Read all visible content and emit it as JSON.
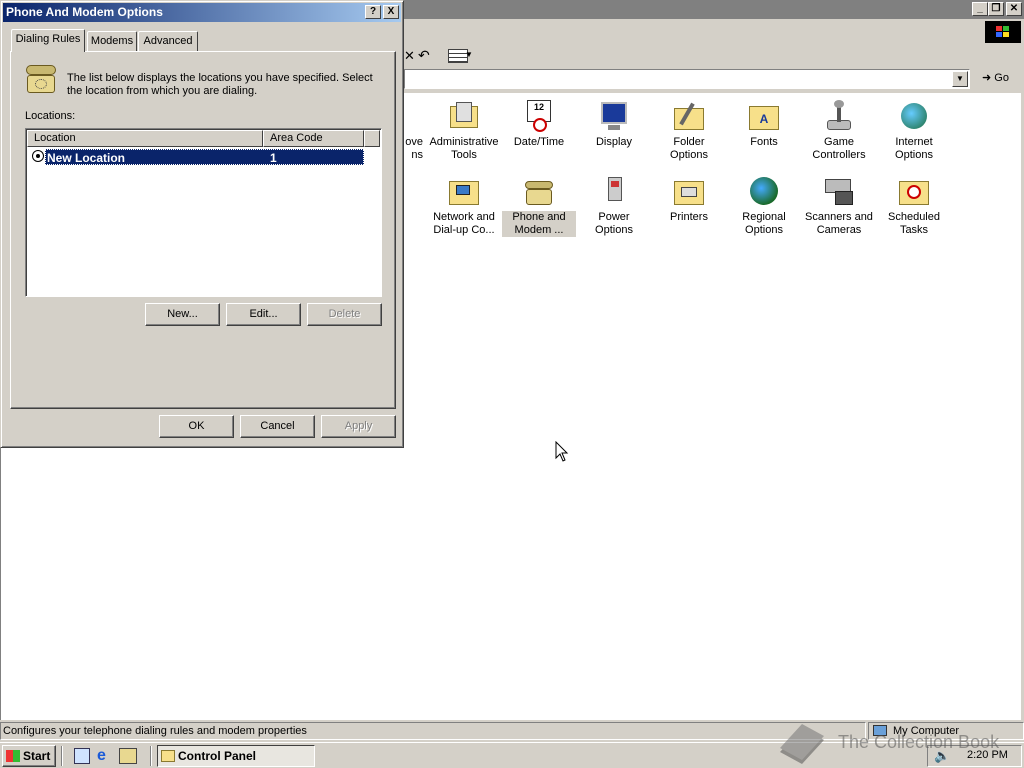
{
  "control_panel": {
    "title": "",
    "toolbar": {
      "views_icon": "views-icon"
    },
    "address": {
      "go_label": "Go"
    },
    "icons": [
      {
        "id": "partial",
        "label": "ove\nns"
      },
      {
        "id": "administrative-tools",
        "label": "Administrative Tools"
      },
      {
        "id": "date-time",
        "label": "Date/Time"
      },
      {
        "id": "display",
        "label": "Display"
      },
      {
        "id": "folder-options",
        "label": "Folder Options"
      },
      {
        "id": "fonts",
        "label": "Fonts"
      },
      {
        "id": "game-controllers",
        "label": "Game Controllers"
      },
      {
        "id": "internet-options",
        "label": "Internet Options"
      },
      {
        "id": "network-dialup",
        "label": "Network and Dial-up Co..."
      },
      {
        "id": "phone-modem",
        "label": "Phone and Modem ..."
      },
      {
        "id": "power-options",
        "label": "Power Options"
      },
      {
        "id": "printers",
        "label": "Printers"
      },
      {
        "id": "regional-options",
        "label": "Regional Options"
      },
      {
        "id": "scanners-cameras",
        "label": "Scanners and Cameras"
      },
      {
        "id": "scheduled-tasks",
        "label": "Scheduled Tasks"
      }
    ],
    "status": {
      "text": "Configures your telephone dialing rules and modem properties",
      "zone": "My Computer"
    }
  },
  "dialog": {
    "title": "Phone And Modem Options",
    "help_button": "?",
    "close_button": "X",
    "tabs": [
      "Dialing Rules",
      "Modems",
      "Advanced"
    ],
    "description": "The list below displays the locations you have specified. Select the location from which you are dialing.",
    "locations_label": "Locations:",
    "columns": [
      "Location",
      "Area Code"
    ],
    "rows": [
      {
        "location": "New Location",
        "area_code": "1"
      }
    ],
    "buttons": {
      "new": "New...",
      "edit": "Edit...",
      "delete": "Delete"
    },
    "footer": {
      "ok": "OK",
      "cancel": "Cancel",
      "apply": "Apply"
    }
  },
  "taskbar": {
    "start": "Start",
    "task": "Control Panel",
    "clock": "2:20 PM"
  },
  "watermark": "The Collection Book"
}
